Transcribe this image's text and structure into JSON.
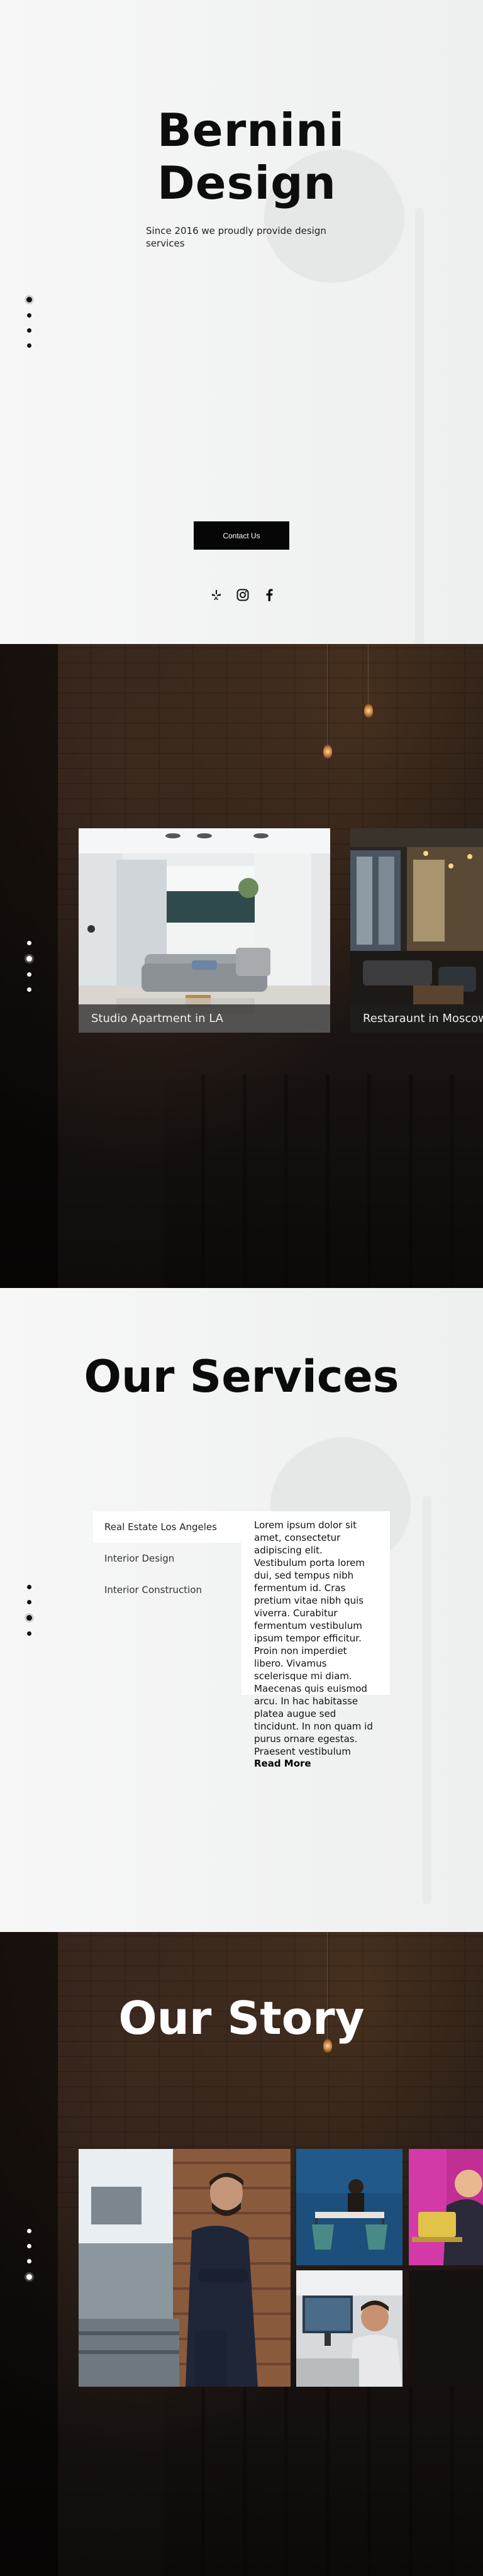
{
  "hero": {
    "title_line1": "Bernini",
    "title_line2": "Design",
    "subtitle": "Since 2016 we proudly provide design services",
    "contact_label": "Contact Us",
    "socials": [
      "yelp-icon",
      "instagram-icon",
      "facebook-icon"
    ]
  },
  "projects": {
    "items": [
      {
        "label": "Studio Apartment in LA"
      },
      {
        "label": "Restaraunt in Moscow"
      }
    ]
  },
  "services": {
    "title": "Our Services",
    "tabs": [
      {
        "label": "Real Estate Los Angeles"
      },
      {
        "label": "Interior Design"
      },
      {
        "label": "Interior Construction"
      }
    ],
    "body": "Lorem ipsum dolor sit amet, consectetur adipiscing elit. Vestibulum porta lorem dui, sed tempus nibh fermentum id. Cras pretium vitae nibh quis viverra. Curabitur fermentum vestibulum ipsum tempor efficitur. Proin non imperdiet libero. Vivamus scelerisque mi diam. Maecenas quis euismod arcu. In hac habitasse platea augue sed tincidunt. In non quam id purus ornare egestas. Praesent vestibulum",
    "read_more": "Read More"
  },
  "story": {
    "title": "Our Story"
  },
  "colors": {
    "accent": "#060606",
    "light_bg": "#f4f5f5",
    "dark_bg": "#1a1412"
  }
}
